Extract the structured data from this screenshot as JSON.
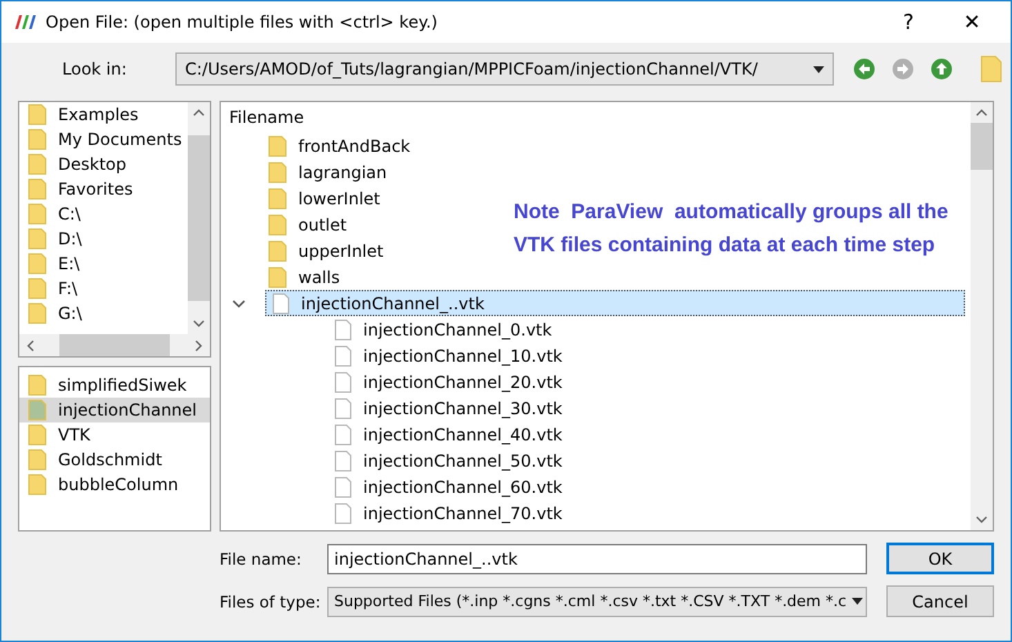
{
  "window": {
    "title": "Open File:  (open multiple files with <ctrl> key.)",
    "help": "?",
    "close": "✕"
  },
  "look_in": {
    "label": "Look in:",
    "path": "C:/Users/AMOD/of_Tuts/lagrangian/MPPICFoam/injectionChannel/VTK/"
  },
  "places": [
    {
      "label": "Examples",
      "selected": false
    },
    {
      "label": "My Documents",
      "selected": false
    },
    {
      "label": "Desktop",
      "selected": false
    },
    {
      "label": "Favorites",
      "selected": false
    },
    {
      "label": "C:\\",
      "selected": false
    },
    {
      "label": "D:\\",
      "selected": false
    },
    {
      "label": "E:\\",
      "selected": false
    },
    {
      "label": "F:\\",
      "selected": false
    },
    {
      "label": "G:\\",
      "selected": false
    }
  ],
  "recent": [
    {
      "label": "simplifiedSiwek",
      "selected": false
    },
    {
      "label": "injectionChannel",
      "selected": true
    },
    {
      "label": "VTK",
      "selected": false
    },
    {
      "label": "Goldschmidt",
      "selected": false
    },
    {
      "label": "bubbleColumn",
      "selected": false
    }
  ],
  "files": {
    "header": "Filename",
    "items": [
      {
        "kind": "folder",
        "name": "frontAndBack",
        "selected": false
      },
      {
        "kind": "folder",
        "name": "lagrangian",
        "selected": false
      },
      {
        "kind": "folder",
        "name": "lowerInlet",
        "selected": false
      },
      {
        "kind": "folder",
        "name": "outlet",
        "selected": false
      },
      {
        "kind": "folder",
        "name": "upperInlet",
        "selected": false
      },
      {
        "kind": "folder",
        "name": "walls",
        "selected": false
      },
      {
        "kind": "group",
        "name": "injectionChannel_..vtk",
        "selected": true,
        "expanded": true,
        "children": [
          {
            "kind": "file",
            "name": "injectionChannel_0.vtk",
            "selected": false
          },
          {
            "kind": "file",
            "name": "injectionChannel_10.vtk",
            "selected": false
          },
          {
            "kind": "file",
            "name": "injectionChannel_20.vtk",
            "selected": false
          },
          {
            "kind": "file",
            "name": "injectionChannel_30.vtk",
            "selected": false
          },
          {
            "kind": "file",
            "name": "injectionChannel_40.vtk",
            "selected": false
          },
          {
            "kind": "file",
            "name": "injectionChannel_50.vtk",
            "selected": false
          },
          {
            "kind": "file",
            "name": "injectionChannel_60.vtk",
            "selected": false
          },
          {
            "kind": "file",
            "name": "injectionChannel_70.vtk",
            "selected": false
          }
        ]
      }
    ]
  },
  "note": "Note  ParaView  automatically groups all the VTK files containing data at each time step",
  "file_name": {
    "label": "File name:",
    "value": "injectionChannel_..vtk"
  },
  "file_type": {
    "label": "Files of type:",
    "value": "Supported Files (*.inp  *.cgns  *.cml  *.csv *.txt *.CSV *.TXT  *.dem  *.c"
  },
  "buttons": [
    {
      "label": "OK",
      "default": true
    },
    {
      "label": "Cancel",
      "default": false
    }
  ]
}
